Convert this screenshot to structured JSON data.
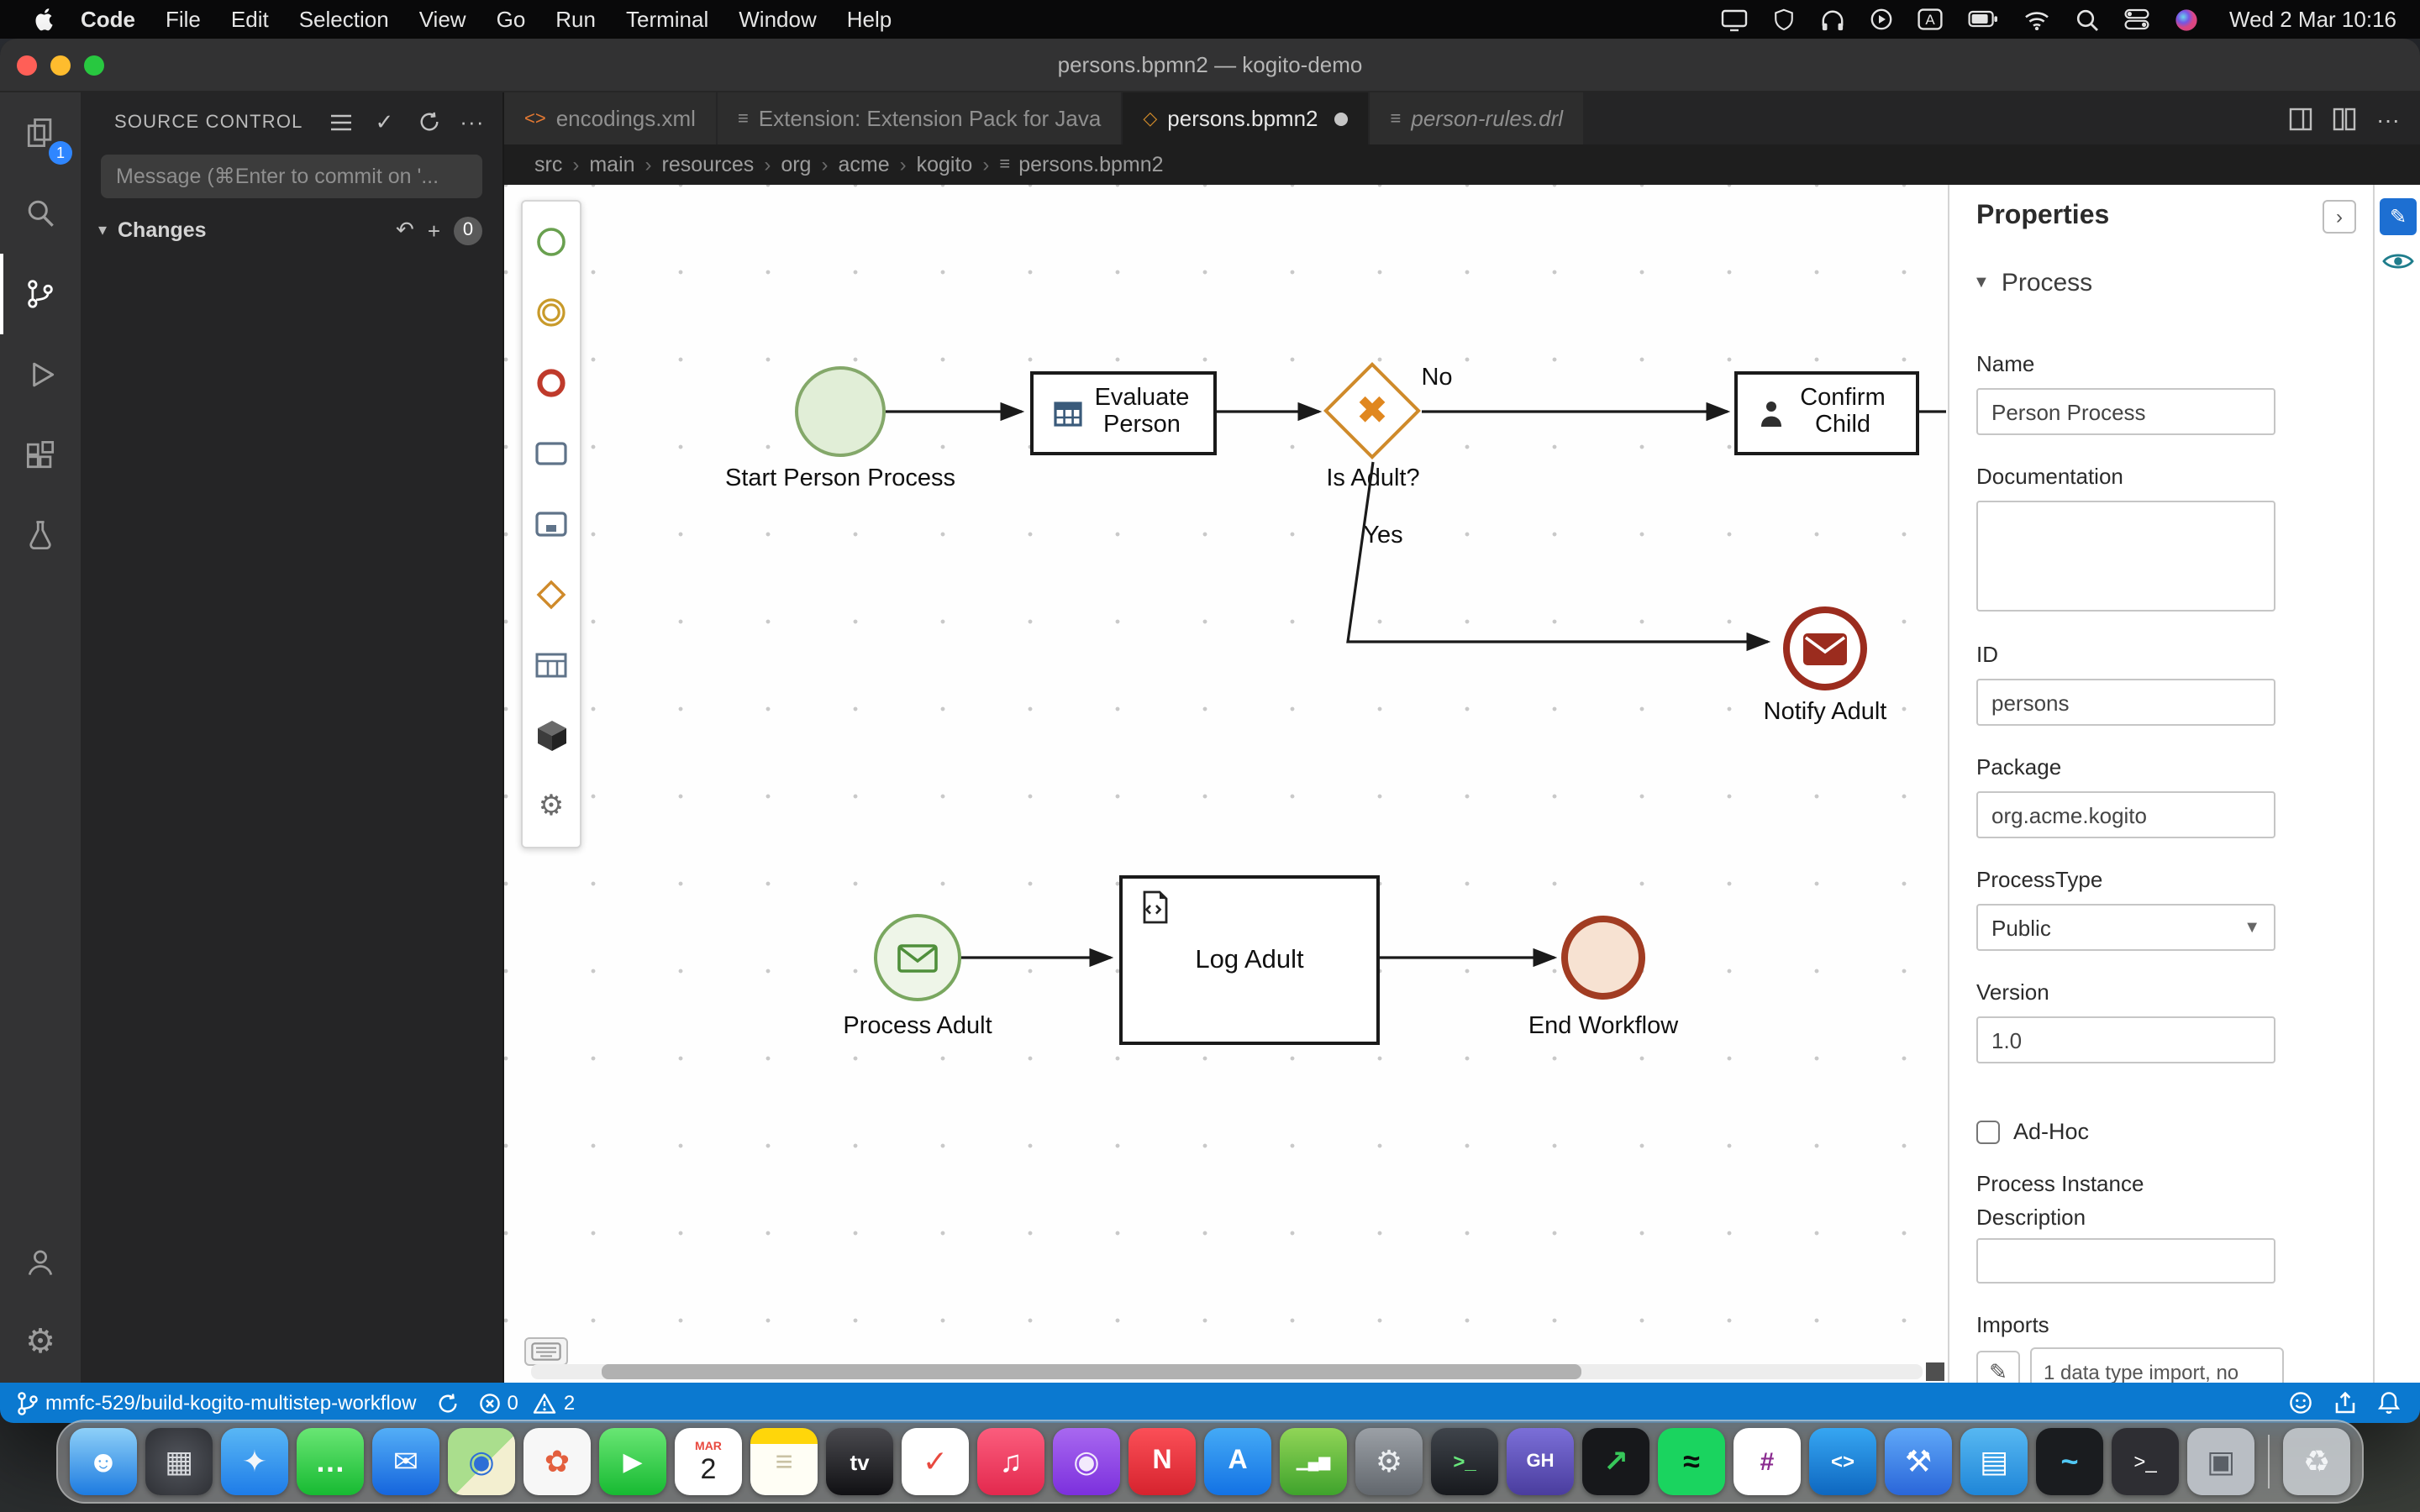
{
  "menubar": {
    "app": "Code",
    "items": [
      "File",
      "Edit",
      "Selection",
      "View",
      "Go",
      "Run",
      "Terminal",
      "Window",
      "Help"
    ],
    "clock": "Wed 2 Mar 10:16"
  },
  "titlebar": {
    "title": "persons.bpmn2 — kogito-demo"
  },
  "activity_bar": {
    "explorer_badge": "1"
  },
  "scm": {
    "header": "SOURCE CONTROL",
    "message_placeholder": "Message (⌘Enter to commit on '...",
    "changes_label": "Changes",
    "changes_count": "0"
  },
  "tabs": [
    {
      "label": "encodings.xml"
    },
    {
      "label": "Extension: Extension Pack for Java"
    },
    {
      "label": "persons.bpmn2"
    },
    {
      "label": "person-rules.drl"
    }
  ],
  "breadcrumb": {
    "items": [
      "src",
      "main",
      "resources",
      "org",
      "acme",
      "kogito"
    ],
    "file": "persons.bpmn2"
  },
  "diagram": {
    "start": "Start Person Process",
    "evaluate": "Evaluate Person",
    "gateway": "Is Adult?",
    "edge_no": "No",
    "edge_yes": "Yes",
    "confirm": "Confirm Child",
    "notify": "Notify Adult",
    "process_adult": "Process Adult",
    "log": "Log Adult",
    "end": "End Workflow"
  },
  "properties": {
    "title": "Properties",
    "section": "Process",
    "name_label": "Name",
    "name_value": "Person Process",
    "documentation_label": "Documentation",
    "documentation_value": "",
    "id_label": "ID",
    "id_value": "persons",
    "package_label": "Package",
    "package_value": "org.acme.kogito",
    "process_type_label": "ProcessType",
    "process_type_value": "Public",
    "version_label": "Version",
    "version_value": "1.0",
    "adhoc_label": "Ad-Hoc",
    "process_instance_description_label": "Process Instance Description",
    "process_instance_description_value": "",
    "imports_label": "Imports",
    "imports_value": "1 data type import, no"
  },
  "statusbar": {
    "branch": "mmfc-529/build-kogito-multistep-workflow",
    "errors": "0",
    "warnings": "2"
  },
  "colors": {
    "statusbar": "#0b79d0",
    "start_fill": "#e1eed7",
    "start_border": "#84a86a",
    "gateway_border": "#cf8a2a",
    "gateway_x": "#e0871f",
    "message_end_border": "#9b2c1e",
    "end_fill": "#f7e2d2",
    "end_border": "#a13c22",
    "task_border": "#1a1a1a"
  },
  "dock": {
    "items": [
      {
        "name": "finder",
        "bg": "linear-gradient(180deg,#8ed0f8,#1d7be0)",
        "fg": "#ffffff",
        "glyph": "☻"
      },
      {
        "name": "launchpad",
        "bg": "radial-gradient(circle,#52555c,#2e3035)",
        "fg": "#d8dade",
        "glyph": "▦"
      },
      {
        "name": "safari",
        "bg": "linear-gradient(180deg,#59b7f5,#1e7ce8)",
        "fg": "#f2f6fa",
        "glyph": "✦"
      },
      {
        "name": "messages",
        "bg": "linear-gradient(180deg,#69e674,#17ba32)",
        "fg": "#ffffff",
        "glyph": "…",
        "bold": true
      },
      {
        "name": "mail",
        "bg": "linear-gradient(180deg,#53aef7,#1565dd)",
        "fg": "#ffffff",
        "glyph": "✉"
      },
      {
        "name": "maps",
        "bg": "linear-gradient(135deg,#aade8d 55%,#f3efd0 55%)",
        "fg": "#2e6fd6",
        "glyph": "◉"
      },
      {
        "name": "photos",
        "bg": "#f7f7f7",
        "fg": "#e35f3e",
        "glyph": "✿"
      },
      {
        "name": "facetime",
        "bg": "linear-gradient(180deg,#69e674,#17ba32)",
        "fg": "#ffffff",
        "glyph": "▶",
        "fs": "15px"
      },
      {
        "name": "calendar",
        "bg": "#ffffff",
        "fg": "#222222",
        "glyph": "2",
        "small": "MAR",
        "fs": "17px"
      },
      {
        "name": "notes",
        "bg": "linear-gradient(180deg,#ffd60a 24%,#fffef5 24%)",
        "fg": "#c9c2a4",
        "glyph": "≡"
      },
      {
        "name": "tv",
        "bg": "linear-gradient(180deg,#4a4a4f,#101013)",
        "fg": "#ffffff",
        "glyph": "tv",
        "fs": "13px",
        "bold": true
      },
      {
        "name": "reminders",
        "bg": "#ffffff",
        "fg": "#e8493f",
        "glyph": "✓"
      },
      {
        "name": "music",
        "bg": "linear-gradient(180deg,#fb5d7d,#e3294e)",
        "fg": "#ffffff",
        "glyph": "♫"
      },
      {
        "name": "podcasts",
        "bg": "linear-gradient(180deg,#a868f0,#7c30dd)",
        "fg": "#f2eafc",
        "glyph": "◉"
      },
      {
        "name": "news",
        "bg": "linear-gradient(180deg,#fb4f57,#d6232e)",
        "fg": "#ffffff",
        "glyph": "N",
        "bold": true,
        "fs": "16px"
      },
      {
        "name": "app-store",
        "bg": "linear-gradient(180deg,#44aaf6,#1372e4)",
        "fg": "#ffffff",
        "glyph": "A",
        "bold": true,
        "fs": "16px"
      },
      {
        "name": "numbers",
        "bg": "linear-gradient(180deg,#91d557,#3fa32c)",
        "fg": "#ffffff",
        "glyph": "▁▄▆",
        "fs": "9px"
      },
      {
        "name": "system-settings",
        "bg": "linear-gradient(180deg,#9ba0a6,#62676d)",
        "fg": "#eceff1",
        "glyph": "⚙"
      },
      {
        "name": "iterm",
        "bg": "linear-gradient(180deg,#3f444b,#17191d)",
        "fg": "#68e77b",
        "glyph": ">_",
        "fs": "12px",
        "bold": true
      },
      {
        "name": "github-desktop",
        "bg": "linear-gradient(180deg,#7b6fd8,#4a3d9e)",
        "fg": "#ffffff",
        "glyph": "GH",
        "fs": "11px",
        "bold": true
      },
      {
        "name": "stocks",
        "bg": "#17181b",
        "fg": "#37c75a",
        "glyph": "↗",
        "bold": true
      },
      {
        "name": "spotify",
        "bg": "#1ad45f",
        "fg": "#0c0c0c",
        "glyph": "≈",
        "bold": true
      },
      {
        "name": "slack",
        "bg": "#ffffff",
        "fg": "#8a2b8f",
        "glyph": "#",
        "bold": true,
        "fs": "15px"
      },
      {
        "name": "vscode",
        "bg": "linear-gradient(180deg,#36a6f2,#0e67c0)",
        "fg": "#ffffff",
        "glyph": "<>",
        "fs": "12px",
        "bold": true
      },
      {
        "name": "xcode",
        "bg": "linear-gradient(180deg,#5fa8f8,#2a66d9)",
        "fg": "#ffffff",
        "glyph": "⚒"
      },
      {
        "name": "docker",
        "bg": "linear-gradient(180deg,#57b8f2,#1f86d8)",
        "fg": "#ffffff",
        "glyph": "▤"
      },
      {
        "name": "activity-monitor",
        "bg": "#1a1c1f",
        "fg": "#51c8f5",
        "glyph": "~",
        "bold": true
      },
      {
        "name": "terminal",
        "bg": "#2e2e33",
        "fg": "#ffffff",
        "glyph": ">_",
        "fs": "12px"
      },
      {
        "name": "archive-utility",
        "bg": "#b9bec4",
        "fg": "#5a5f66",
        "glyph": "▣"
      },
      {
        "name": "trash",
        "bg": "rgba(200,204,209,0.85)",
        "fg": "#f2f4f6",
        "glyph": "♻",
        "sep": true
      }
    ]
  }
}
